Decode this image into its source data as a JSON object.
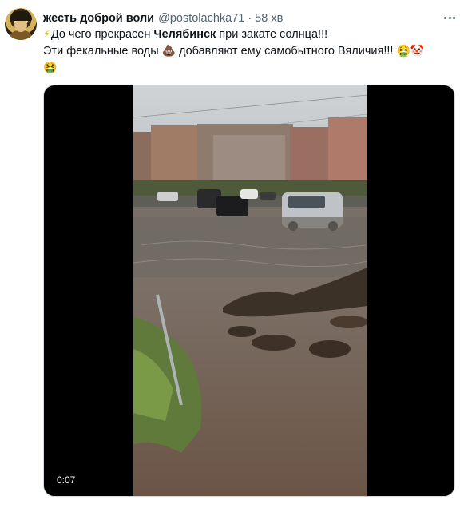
{
  "tweet": {
    "author": {
      "display_name": "жесть доброй воли",
      "handle": "@postolachka71",
      "separator": "·",
      "time": "58 хв"
    },
    "menu_icon": "more-horizontal-icon",
    "text": {
      "line1_pre": "До чего прекрасен ",
      "line1_city": "Челябинск",
      "line1_post": " при закате солнца!!!",
      "line2": "Эти фекальные воды ",
      "line2_mid": " добавляют ему самобытного Вяличия!!! ",
      "emojis": {
        "bolt": "⚡",
        "poo": "💩",
        "sick": "🤮",
        "clown": "🤡"
      }
    },
    "media": {
      "type": "video",
      "duration": "0:07"
    }
  },
  "colors": {
    "text_primary": "#0f1419",
    "text_secondary": "#536471",
    "media_background": "#000000"
  }
}
